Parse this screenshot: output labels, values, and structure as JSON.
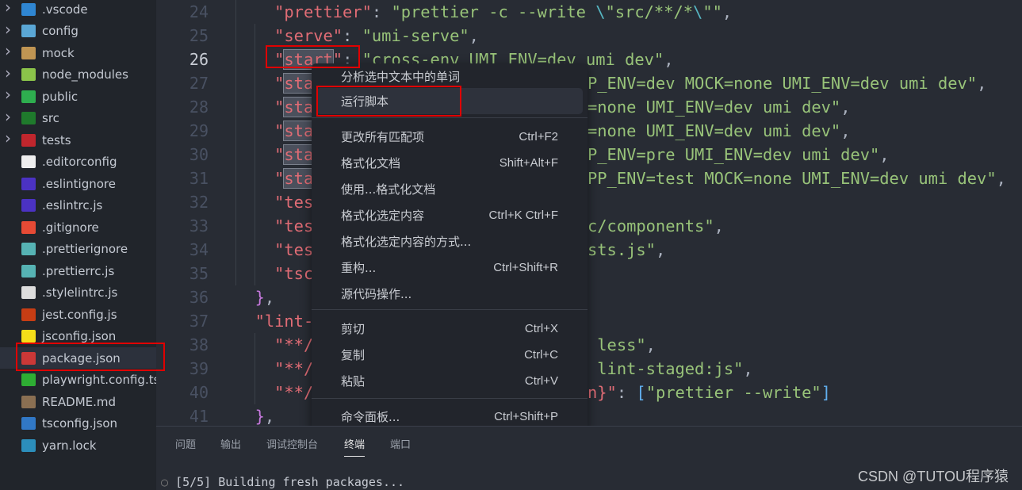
{
  "sidebar": {
    "items": [
      {
        "label": ".vscode",
        "folder": true,
        "icon": "vscode-folder-icon",
        "color": "#2f86d2"
      },
      {
        "label": "config",
        "folder": true,
        "icon": "config-folder-icon",
        "color": "#5aa7d6"
      },
      {
        "label": "mock",
        "folder": true,
        "icon": "folder-icon",
        "color": "#c09553"
      },
      {
        "label": "node_modules",
        "folder": true,
        "icon": "node-folder-icon",
        "color": "#8bc34a"
      },
      {
        "label": "public",
        "folder": true,
        "icon": "public-folder-icon",
        "color": "#2eae4f"
      },
      {
        "label": "src",
        "folder": true,
        "icon": "src-folder-icon",
        "color": "#1f7a2c"
      },
      {
        "label": "tests",
        "folder": true,
        "icon": "tests-folder-icon",
        "color": "#c0262d"
      },
      {
        "label": ".editorconfig",
        "icon": "editorconfig-icon",
        "color": "#eeeeee"
      },
      {
        "label": ".eslintignore",
        "icon": "eslint-icon",
        "color": "#4b32c3"
      },
      {
        "label": ".eslintrc.js",
        "icon": "eslint-icon",
        "color": "#4b32c3"
      },
      {
        "label": ".gitignore",
        "icon": "git-icon",
        "color": "#e64a35"
      },
      {
        "label": ".prettierignore",
        "icon": "prettier-icon",
        "color": "#56b3b4"
      },
      {
        "label": ".prettierrc.js",
        "icon": "prettier-icon",
        "color": "#56b3b4"
      },
      {
        "label": ".stylelintrc.js",
        "icon": "stylelint-icon",
        "color": "#dddddd"
      },
      {
        "label": "jest.config.js",
        "icon": "jest-icon",
        "color": "#c63d14"
      },
      {
        "label": "jsconfig.json",
        "icon": "js-icon",
        "color": "#f5de19"
      },
      {
        "label": "package.json",
        "icon": "npm-icon",
        "color": "#cb3837",
        "active": true
      },
      {
        "label": "playwright.config.ts",
        "icon": "playwright-icon",
        "color": "#2ead33"
      },
      {
        "label": "README.md",
        "icon": "markdown-icon",
        "color": "#8a6f52"
      },
      {
        "label": "tsconfig.json",
        "icon": "ts-icon",
        "color": "#3178c6"
      },
      {
        "label": "yarn.lock",
        "icon": "yarn-icon",
        "color": "#2c8ebb"
      }
    ]
  },
  "editor": {
    "current_line": "26",
    "lines": [
      {
        "n": "24",
        "l": [
          [
            "p",
            "    "
          ],
          [
            "k",
            "\"prettier\""
          ],
          [
            "p",
            ": "
          ],
          [
            "s",
            "\"prettier -c --write "
          ],
          [
            "e",
            "\\"
          ],
          [
            "s",
            "\"src/**/*"
          ],
          [
            "e",
            "\\"
          ],
          [
            "s",
            "\"\""
          ],
          [
            "p",
            ","
          ]
        ]
      },
      {
        "n": "25",
        "l": [
          [
            "p",
            "    "
          ],
          [
            "k",
            "\"serve\""
          ],
          [
            "p",
            ": "
          ],
          [
            "s",
            "\"umi-serve\""
          ],
          [
            "p",
            ","
          ]
        ]
      },
      {
        "n": "26",
        "l": [
          [
            "p",
            "    "
          ],
          [
            "k",
            "\""
          ],
          [
            "ks",
            "start"
          ],
          [
            "k",
            "\""
          ],
          [
            "p",
            ": "
          ],
          [
            "s",
            "\"cross-env UMI_ENV=dev umi dev\""
          ],
          [
            "p",
            ","
          ]
        ]
      },
      {
        "n": "27",
        "l": [
          [
            "p",
            "    "
          ],
          [
            "k",
            "\""
          ],
          [
            "ks",
            "sta"
          ]
        ],
        "r": [
          [
            "s",
            "P_ENV=dev MOCK=none UMI_ENV=dev umi dev\""
          ],
          [
            "p",
            ","
          ]
        ]
      },
      {
        "n": "28",
        "l": [
          [
            "p",
            "    "
          ],
          [
            "k",
            "\""
          ],
          [
            "ks",
            "sta"
          ]
        ],
        "r": [
          [
            "s",
            "=none UMI_ENV=dev umi dev\""
          ],
          [
            "p",
            ","
          ]
        ]
      },
      {
        "n": "29",
        "l": [
          [
            "p",
            "    "
          ],
          [
            "k",
            "\""
          ],
          [
            "ks",
            "sta"
          ]
        ],
        "r": [
          [
            "s",
            "=none UMI_ENV=dev umi dev\""
          ],
          [
            "p",
            ","
          ]
        ]
      },
      {
        "n": "30",
        "l": [
          [
            "p",
            "    "
          ],
          [
            "k",
            "\""
          ],
          [
            "ks",
            "sta"
          ]
        ],
        "r": [
          [
            "s",
            "P_ENV=pre UMI_ENV=dev umi dev\""
          ],
          [
            "p",
            ","
          ]
        ]
      },
      {
        "n": "31",
        "l": [
          [
            "p",
            "    "
          ],
          [
            "k",
            "\""
          ],
          [
            "ks",
            "sta"
          ]
        ],
        "r": [
          [
            "s",
            "PP_ENV=test MOCK=none UMI_ENV=dev umi dev\""
          ],
          [
            "p",
            ","
          ]
        ]
      },
      {
        "n": "32",
        "l": [
          [
            "p",
            "    "
          ],
          [
            "k",
            "\"tes"
          ]
        ]
      },
      {
        "n": "33",
        "l": [
          [
            "p",
            "    "
          ],
          [
            "k",
            "\"tes"
          ]
        ],
        "r": [
          [
            "s",
            "c/components\""
          ],
          [
            "p",
            ","
          ]
        ]
      },
      {
        "n": "34",
        "l": [
          [
            "p",
            "    "
          ],
          [
            "k",
            "\"tes"
          ]
        ],
        "r": [
          [
            "s",
            "sts.js\""
          ],
          [
            "p",
            ","
          ]
        ]
      },
      {
        "n": "35",
        "l": [
          [
            "p",
            "    "
          ],
          [
            "k",
            "\"tsc"
          ]
        ]
      },
      {
        "n": "36",
        "l": [
          [
            "p",
            "  "
          ],
          [
            "b",
            "}"
          ],
          [
            "p",
            ","
          ]
        ]
      },
      {
        "n": "37",
        "l": [
          [
            "p",
            "  "
          ],
          [
            "k",
            "\"lint-"
          ]
        ]
      },
      {
        "n": "38",
        "l": [
          [
            "p",
            "    "
          ],
          [
            "k",
            "\"**/"
          ]
        ],
        "r": [
          [
            "s",
            " less\""
          ],
          [
            "p",
            ","
          ]
        ]
      },
      {
        "n": "39",
        "l": [
          [
            "p",
            "    "
          ],
          [
            "k",
            "\"**/"
          ]
        ],
        "r": [
          [
            "s",
            " lint-staged:js\""
          ],
          [
            "p",
            ","
          ]
        ]
      },
      {
        "n": "40",
        "l": [
          [
            "p",
            "    "
          ],
          [
            "k",
            "\"**/"
          ]
        ],
        "r": [
          [
            "k",
            "n}\""
          ],
          [
            "p",
            ": "
          ],
          [
            "a",
            "["
          ],
          [
            "s",
            "\"prettier --write\""
          ],
          [
            "a",
            "]"
          ]
        ]
      },
      {
        "n": "41",
        "l": [
          [
            "p",
            "  "
          ],
          [
            "b",
            "}"
          ],
          [
            "p",
            ","
          ]
        ]
      }
    ]
  },
  "context_menu": {
    "items": [
      {
        "label": "分析选中文本中的单词",
        "shortcut": ""
      },
      {
        "label": "运行脚本",
        "shortcut": "",
        "highlighted": true
      },
      {
        "label": "更改所有匹配项",
        "shortcut": "Ctrl+F2"
      },
      {
        "label": "格式化文档",
        "shortcut": "Shift+Alt+F"
      },
      {
        "label": "使用...格式化文档",
        "shortcut": ""
      },
      {
        "label": "格式化选定内容",
        "shortcut": "Ctrl+K Ctrl+F"
      },
      {
        "label": "格式化选定内容的方式...",
        "shortcut": ""
      },
      {
        "label": "重构...",
        "shortcut": "Ctrl+Shift+R"
      },
      {
        "label": "源代码操作...",
        "shortcut": ""
      },
      {
        "label": "剪切",
        "shortcut": "Ctrl+X"
      },
      {
        "label": "复制",
        "shortcut": "Ctrl+C"
      },
      {
        "label": "粘贴",
        "shortcut": "Ctrl+V"
      },
      {
        "label": "命令面板...",
        "shortcut": "Ctrl+Shift+P"
      }
    ]
  },
  "panel": {
    "tabs": [
      "问题",
      "输出",
      "调试控制台",
      "终端",
      "端口"
    ],
    "active_tab": "终端",
    "terminal_line": "[5/5] Building fresh packages..."
  },
  "watermark": "CSDN @TUTOU程序猿",
  "colors": {
    "annotation_red": "#e00000",
    "key": "#e06c75",
    "string": "#98c379"
  }
}
